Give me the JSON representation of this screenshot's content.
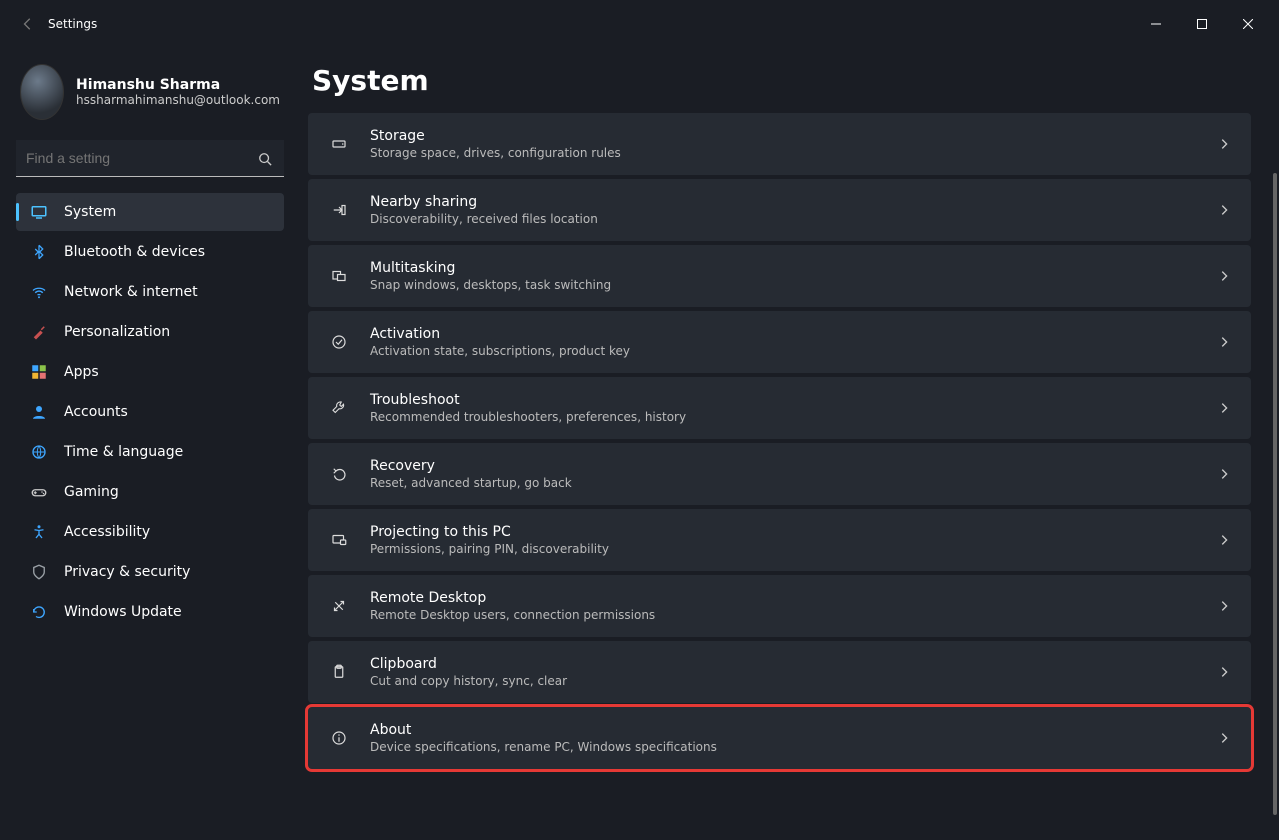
{
  "window": {
    "title": "Settings"
  },
  "user": {
    "name": "Himanshu Sharma",
    "email": "hssharmahimanshu@outlook.com"
  },
  "search": {
    "placeholder": "Find a setting"
  },
  "nav": {
    "items": [
      {
        "label": "System",
        "icon": "display-icon",
        "active": true
      },
      {
        "label": "Bluetooth & devices",
        "icon": "bluetooth-icon"
      },
      {
        "label": "Network & internet",
        "icon": "wifi-icon"
      },
      {
        "label": "Personalization",
        "icon": "brush-icon"
      },
      {
        "label": "Apps",
        "icon": "apps-icon"
      },
      {
        "label": "Accounts",
        "icon": "person-icon"
      },
      {
        "label": "Time & language",
        "icon": "globe-clock-icon"
      },
      {
        "label": "Gaming",
        "icon": "gamepad-icon"
      },
      {
        "label": "Accessibility",
        "icon": "accessibility-icon"
      },
      {
        "label": "Privacy & security",
        "icon": "shield-icon"
      },
      {
        "label": "Windows Update",
        "icon": "update-icon"
      }
    ]
  },
  "page": {
    "heading": "System",
    "items": [
      {
        "title": "Storage",
        "desc": "Storage space, drives, configuration rules",
        "icon": "storage-icon"
      },
      {
        "title": "Nearby sharing",
        "desc": "Discoverability, received files location",
        "icon": "share-icon"
      },
      {
        "title": "Multitasking",
        "desc": "Snap windows, desktops, task switching",
        "icon": "multitask-icon"
      },
      {
        "title": "Activation",
        "desc": "Activation state, subscriptions, product key",
        "icon": "check-icon"
      },
      {
        "title": "Troubleshoot",
        "desc": "Recommended troubleshooters, preferences, history",
        "icon": "wrench-icon"
      },
      {
        "title": "Recovery",
        "desc": "Reset, advanced startup, go back",
        "icon": "recovery-icon"
      },
      {
        "title": "Projecting to this PC",
        "desc": "Permissions, pairing PIN, discoverability",
        "icon": "project-icon"
      },
      {
        "title": "Remote Desktop",
        "desc": "Remote Desktop users, connection permissions",
        "icon": "remote-icon"
      },
      {
        "title": "Clipboard",
        "desc": "Cut and copy history, sync, clear",
        "icon": "clipboard-icon"
      },
      {
        "title": "About",
        "desc": "Device specifications, rename PC, Windows specifications",
        "icon": "info-icon",
        "highlighted": true
      }
    ]
  }
}
